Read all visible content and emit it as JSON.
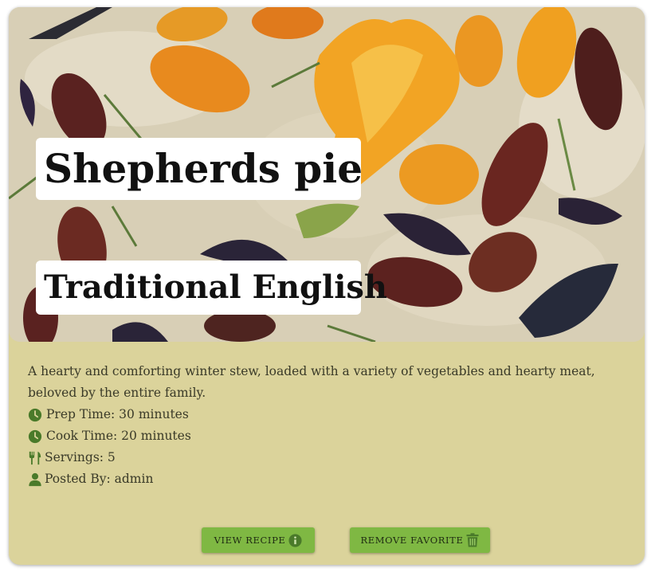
{
  "recipe": {
    "title": "Shepherds pie",
    "cuisine": "Traditional English",
    "description": "A hearty and comforting winter stew, loaded with a variety of vegetables and hearty meat, beloved by the entire family.",
    "prep_time": "Prep Time: 30 minutes",
    "cook_time": "Cook Time: 20 minutes",
    "servings": "Servings: 5",
    "posted_by": "Posted By: admin"
  },
  "actions": {
    "view_label": "View Recipe",
    "remove_label": "Remove Favorite"
  },
  "icons": {
    "prep": "clock-icon",
    "cook": "clock-icon",
    "servings": "utensils-icon",
    "posted_by": "user-icon",
    "view": "info-icon",
    "remove": "trash-icon"
  },
  "colors": {
    "card_background": "#dbd39b",
    "button": "#7fb843",
    "icon": "#4a7a2a"
  }
}
